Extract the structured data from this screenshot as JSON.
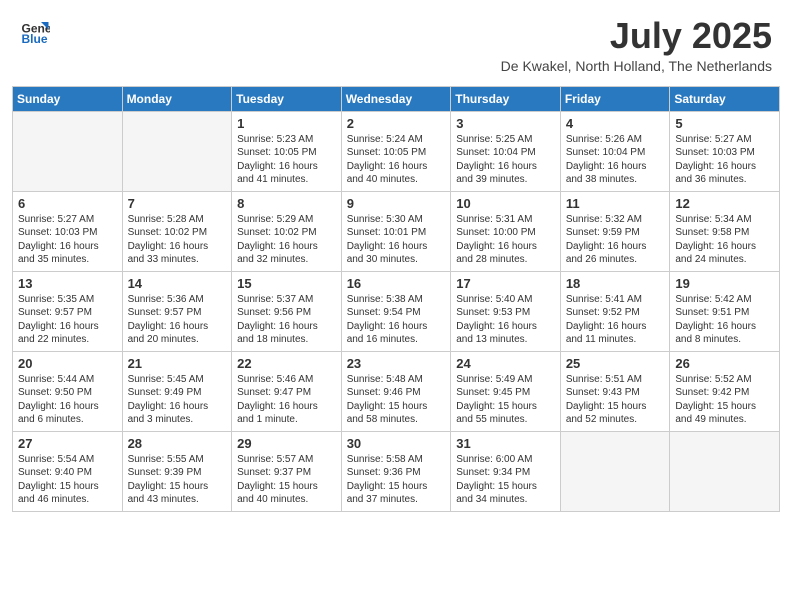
{
  "header": {
    "logo_line1": "General",
    "logo_line2": "Blue",
    "month_title": "July 2025",
    "location": "De Kwakel, North Holland, The Netherlands"
  },
  "days_of_week": [
    "Sunday",
    "Monday",
    "Tuesday",
    "Wednesday",
    "Thursday",
    "Friday",
    "Saturday"
  ],
  "weeks": [
    [
      {
        "day": "",
        "info": ""
      },
      {
        "day": "",
        "info": ""
      },
      {
        "day": "1",
        "info": "Sunrise: 5:23 AM\nSunset: 10:05 PM\nDaylight: 16 hours\nand 41 minutes."
      },
      {
        "day": "2",
        "info": "Sunrise: 5:24 AM\nSunset: 10:05 PM\nDaylight: 16 hours\nand 40 minutes."
      },
      {
        "day": "3",
        "info": "Sunrise: 5:25 AM\nSunset: 10:04 PM\nDaylight: 16 hours\nand 39 minutes."
      },
      {
        "day": "4",
        "info": "Sunrise: 5:26 AM\nSunset: 10:04 PM\nDaylight: 16 hours\nand 38 minutes."
      },
      {
        "day": "5",
        "info": "Sunrise: 5:27 AM\nSunset: 10:03 PM\nDaylight: 16 hours\nand 36 minutes."
      }
    ],
    [
      {
        "day": "6",
        "info": "Sunrise: 5:27 AM\nSunset: 10:03 PM\nDaylight: 16 hours\nand 35 minutes."
      },
      {
        "day": "7",
        "info": "Sunrise: 5:28 AM\nSunset: 10:02 PM\nDaylight: 16 hours\nand 33 minutes."
      },
      {
        "day": "8",
        "info": "Sunrise: 5:29 AM\nSunset: 10:02 PM\nDaylight: 16 hours\nand 32 minutes."
      },
      {
        "day": "9",
        "info": "Sunrise: 5:30 AM\nSunset: 10:01 PM\nDaylight: 16 hours\nand 30 minutes."
      },
      {
        "day": "10",
        "info": "Sunrise: 5:31 AM\nSunset: 10:00 PM\nDaylight: 16 hours\nand 28 minutes."
      },
      {
        "day": "11",
        "info": "Sunrise: 5:32 AM\nSunset: 9:59 PM\nDaylight: 16 hours\nand 26 minutes."
      },
      {
        "day": "12",
        "info": "Sunrise: 5:34 AM\nSunset: 9:58 PM\nDaylight: 16 hours\nand 24 minutes."
      }
    ],
    [
      {
        "day": "13",
        "info": "Sunrise: 5:35 AM\nSunset: 9:57 PM\nDaylight: 16 hours\nand 22 minutes."
      },
      {
        "day": "14",
        "info": "Sunrise: 5:36 AM\nSunset: 9:57 PM\nDaylight: 16 hours\nand 20 minutes."
      },
      {
        "day": "15",
        "info": "Sunrise: 5:37 AM\nSunset: 9:56 PM\nDaylight: 16 hours\nand 18 minutes."
      },
      {
        "day": "16",
        "info": "Sunrise: 5:38 AM\nSunset: 9:54 PM\nDaylight: 16 hours\nand 16 minutes."
      },
      {
        "day": "17",
        "info": "Sunrise: 5:40 AM\nSunset: 9:53 PM\nDaylight: 16 hours\nand 13 minutes."
      },
      {
        "day": "18",
        "info": "Sunrise: 5:41 AM\nSunset: 9:52 PM\nDaylight: 16 hours\nand 11 minutes."
      },
      {
        "day": "19",
        "info": "Sunrise: 5:42 AM\nSunset: 9:51 PM\nDaylight: 16 hours\nand 8 minutes."
      }
    ],
    [
      {
        "day": "20",
        "info": "Sunrise: 5:44 AM\nSunset: 9:50 PM\nDaylight: 16 hours\nand 6 minutes."
      },
      {
        "day": "21",
        "info": "Sunrise: 5:45 AM\nSunset: 9:49 PM\nDaylight: 16 hours\nand 3 minutes."
      },
      {
        "day": "22",
        "info": "Sunrise: 5:46 AM\nSunset: 9:47 PM\nDaylight: 16 hours\nand 1 minute."
      },
      {
        "day": "23",
        "info": "Sunrise: 5:48 AM\nSunset: 9:46 PM\nDaylight: 15 hours\nand 58 minutes."
      },
      {
        "day": "24",
        "info": "Sunrise: 5:49 AM\nSunset: 9:45 PM\nDaylight: 15 hours\nand 55 minutes."
      },
      {
        "day": "25",
        "info": "Sunrise: 5:51 AM\nSunset: 9:43 PM\nDaylight: 15 hours\nand 52 minutes."
      },
      {
        "day": "26",
        "info": "Sunrise: 5:52 AM\nSunset: 9:42 PM\nDaylight: 15 hours\nand 49 minutes."
      }
    ],
    [
      {
        "day": "27",
        "info": "Sunrise: 5:54 AM\nSunset: 9:40 PM\nDaylight: 15 hours\nand 46 minutes."
      },
      {
        "day": "28",
        "info": "Sunrise: 5:55 AM\nSunset: 9:39 PM\nDaylight: 15 hours\nand 43 minutes."
      },
      {
        "day": "29",
        "info": "Sunrise: 5:57 AM\nSunset: 9:37 PM\nDaylight: 15 hours\nand 40 minutes."
      },
      {
        "day": "30",
        "info": "Sunrise: 5:58 AM\nSunset: 9:36 PM\nDaylight: 15 hours\nand 37 minutes."
      },
      {
        "day": "31",
        "info": "Sunrise: 6:00 AM\nSunset: 9:34 PM\nDaylight: 15 hours\nand 34 minutes."
      },
      {
        "day": "",
        "info": ""
      },
      {
        "day": "",
        "info": ""
      }
    ]
  ]
}
